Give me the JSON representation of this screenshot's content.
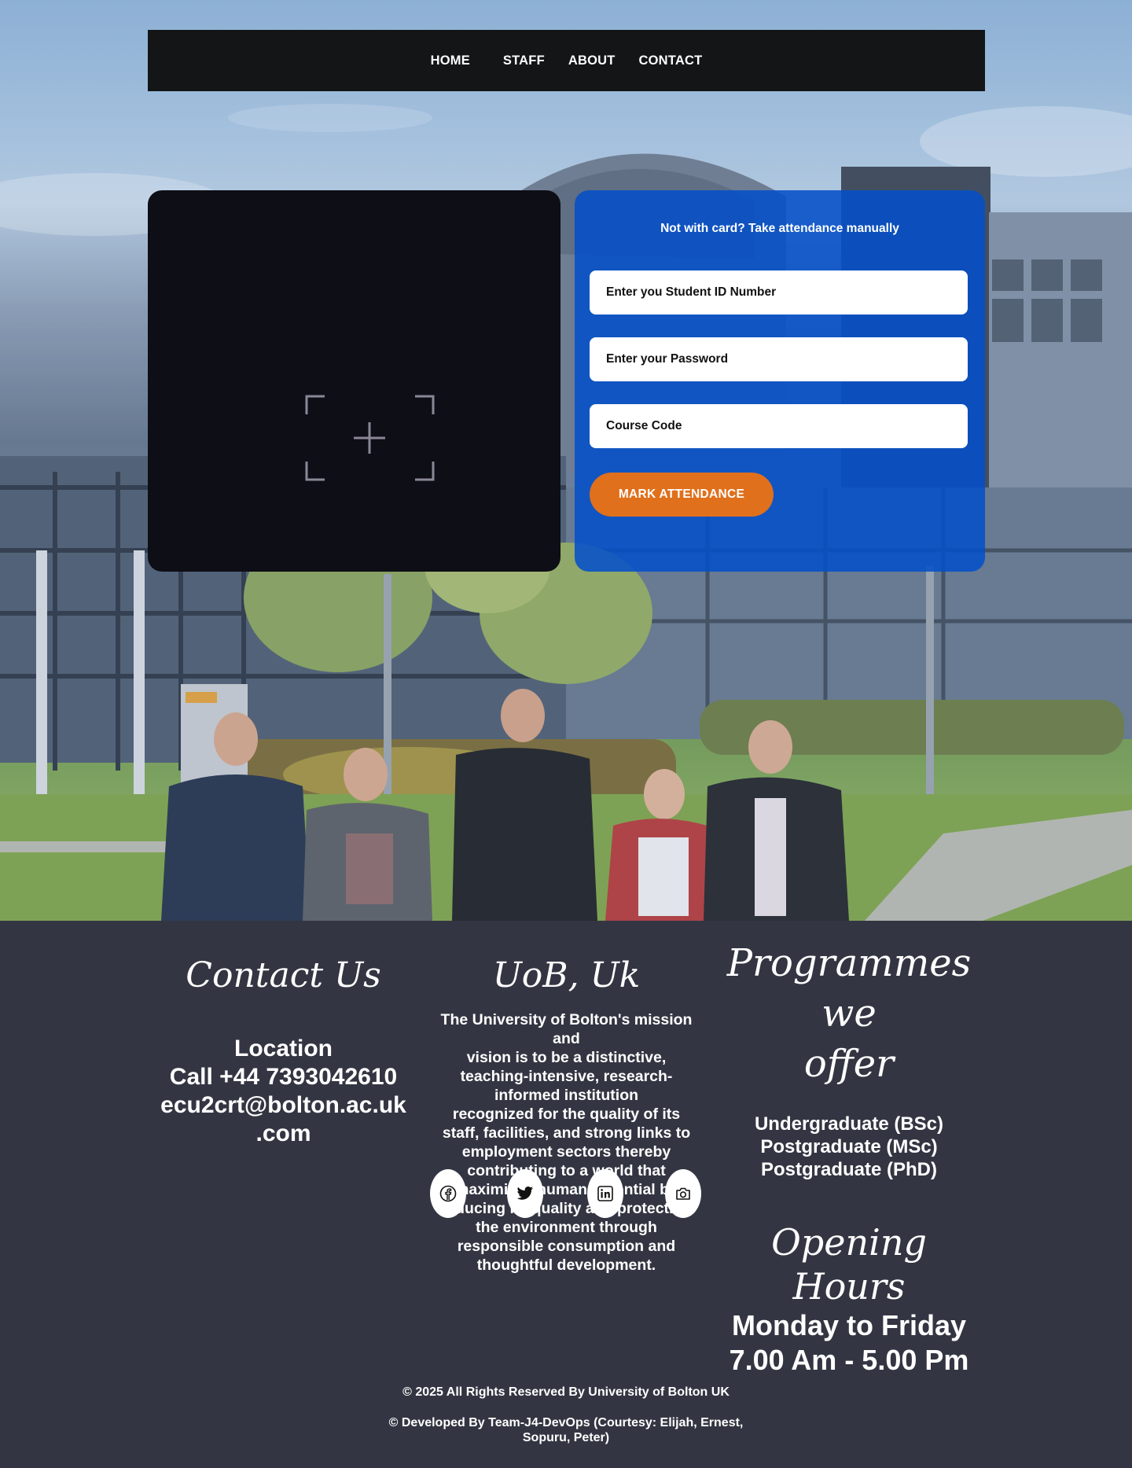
{
  "nav": {
    "home": "HOME",
    "staff": "STAFF",
    "about": "ABOUT",
    "contact": "CONTACT"
  },
  "manual": {
    "title": "Not with card? Take attendance manually",
    "student_id_placeholder": "Enter you Student ID Number",
    "password_placeholder": "Enter your Password",
    "course_code_placeholder": "Course Code",
    "mark_button": "MARK ATTENDANCE"
  },
  "footer": {
    "contact": {
      "title": "Contact Us",
      "location": "Location",
      "phone": "Call +44 7393042610",
      "email_line1": "ecu2crt@bolton.ac.uk",
      "email_line2": ".com"
    },
    "uob": {
      "title": "UoB, Uk",
      "mission_lines": [
        "The University of Bolton's mission",
        "and",
        "vision is to be a distinctive,",
        "teaching-intensive, research-",
        "informed institution",
        "recognized for the quality of its",
        "staff, facilities, and strong links to",
        "employment sectors thereby",
        "contributing to a world that",
        "maximizes human potential by",
        "reducing inequality and protecting",
        "the environment through",
        "responsible consumption and",
        "thoughtful development."
      ]
    },
    "programmes": {
      "title_line1": "Programmes we",
      "title_line2": "offer",
      "items": [
        "Undergraduate (BSc)",
        "Postgraduate (MSc)",
        "Postgraduate (PhD)"
      ]
    },
    "hours": {
      "title": "Opening Hours",
      "days": "Monday to Friday",
      "time": "7.00 Am - 5.00 Pm"
    },
    "socials": [
      "facebook-icon",
      "twitter-icon",
      "linkedin-icon",
      "instagram-icon"
    ],
    "copyright": "© 2025 All Rights Reserved By University of Bolton UK",
    "developed_line1": "© Developed By Team-J4-DevOps (Courtesy: Elijah, Ernest,",
    "developed_line2": "Sopuru, Peter)"
  },
  "colors": {
    "nav_bg": "#141517",
    "scanner_bg": "#0e0e16",
    "manual_bg": "#0550c8",
    "button_orange": "#e0701c",
    "footer_bg": "#333642"
  }
}
